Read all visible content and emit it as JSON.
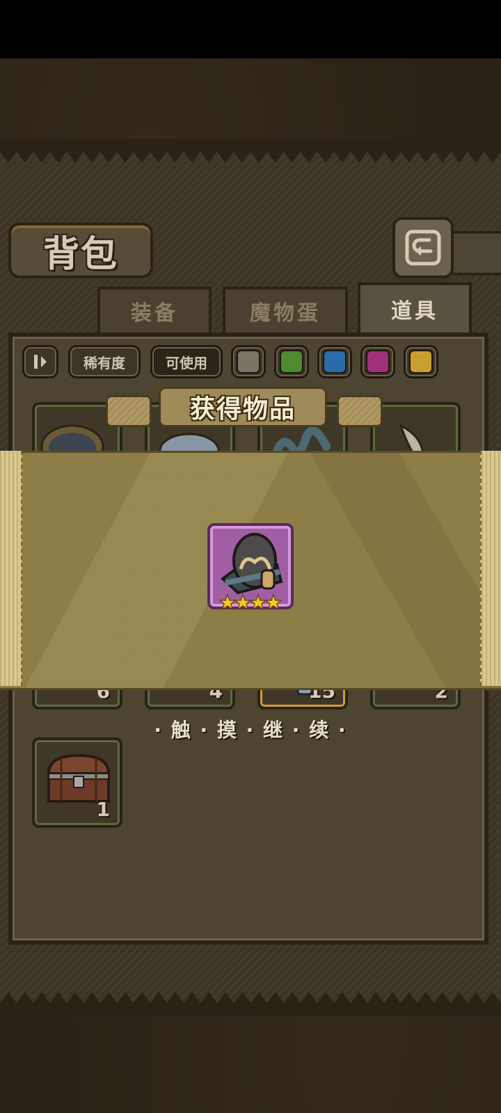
{
  "header": {
    "title": "背包"
  },
  "tabs": [
    {
      "label": "装备",
      "active": false
    },
    {
      "label": "魔物蛋",
      "active": false
    },
    {
      "label": "道具",
      "active": true
    }
  ],
  "filters": {
    "rarity_label": "稀有度",
    "usable_label": "可使用",
    "color_swatches": [
      "#7a7466",
      "#4f8a2e",
      "#2a6ca8",
      "#a0307a",
      "#c9a030"
    ]
  },
  "inventory": {
    "counts_row2": [
      "6",
      "4",
      "15",
      "2"
    ],
    "chest_count": "1"
  },
  "reward_popup": {
    "title": "获得物品",
    "item_icon": "monster-egg-icon",
    "item_rarity_stars": 4,
    "continue_hint": "· 触 · 摸 · 继 · 续 ·"
  },
  "colors": {
    "reward_card_border": "#a25ea4",
    "banner_bg": "#8d7d47",
    "star": "#f7c62b"
  }
}
